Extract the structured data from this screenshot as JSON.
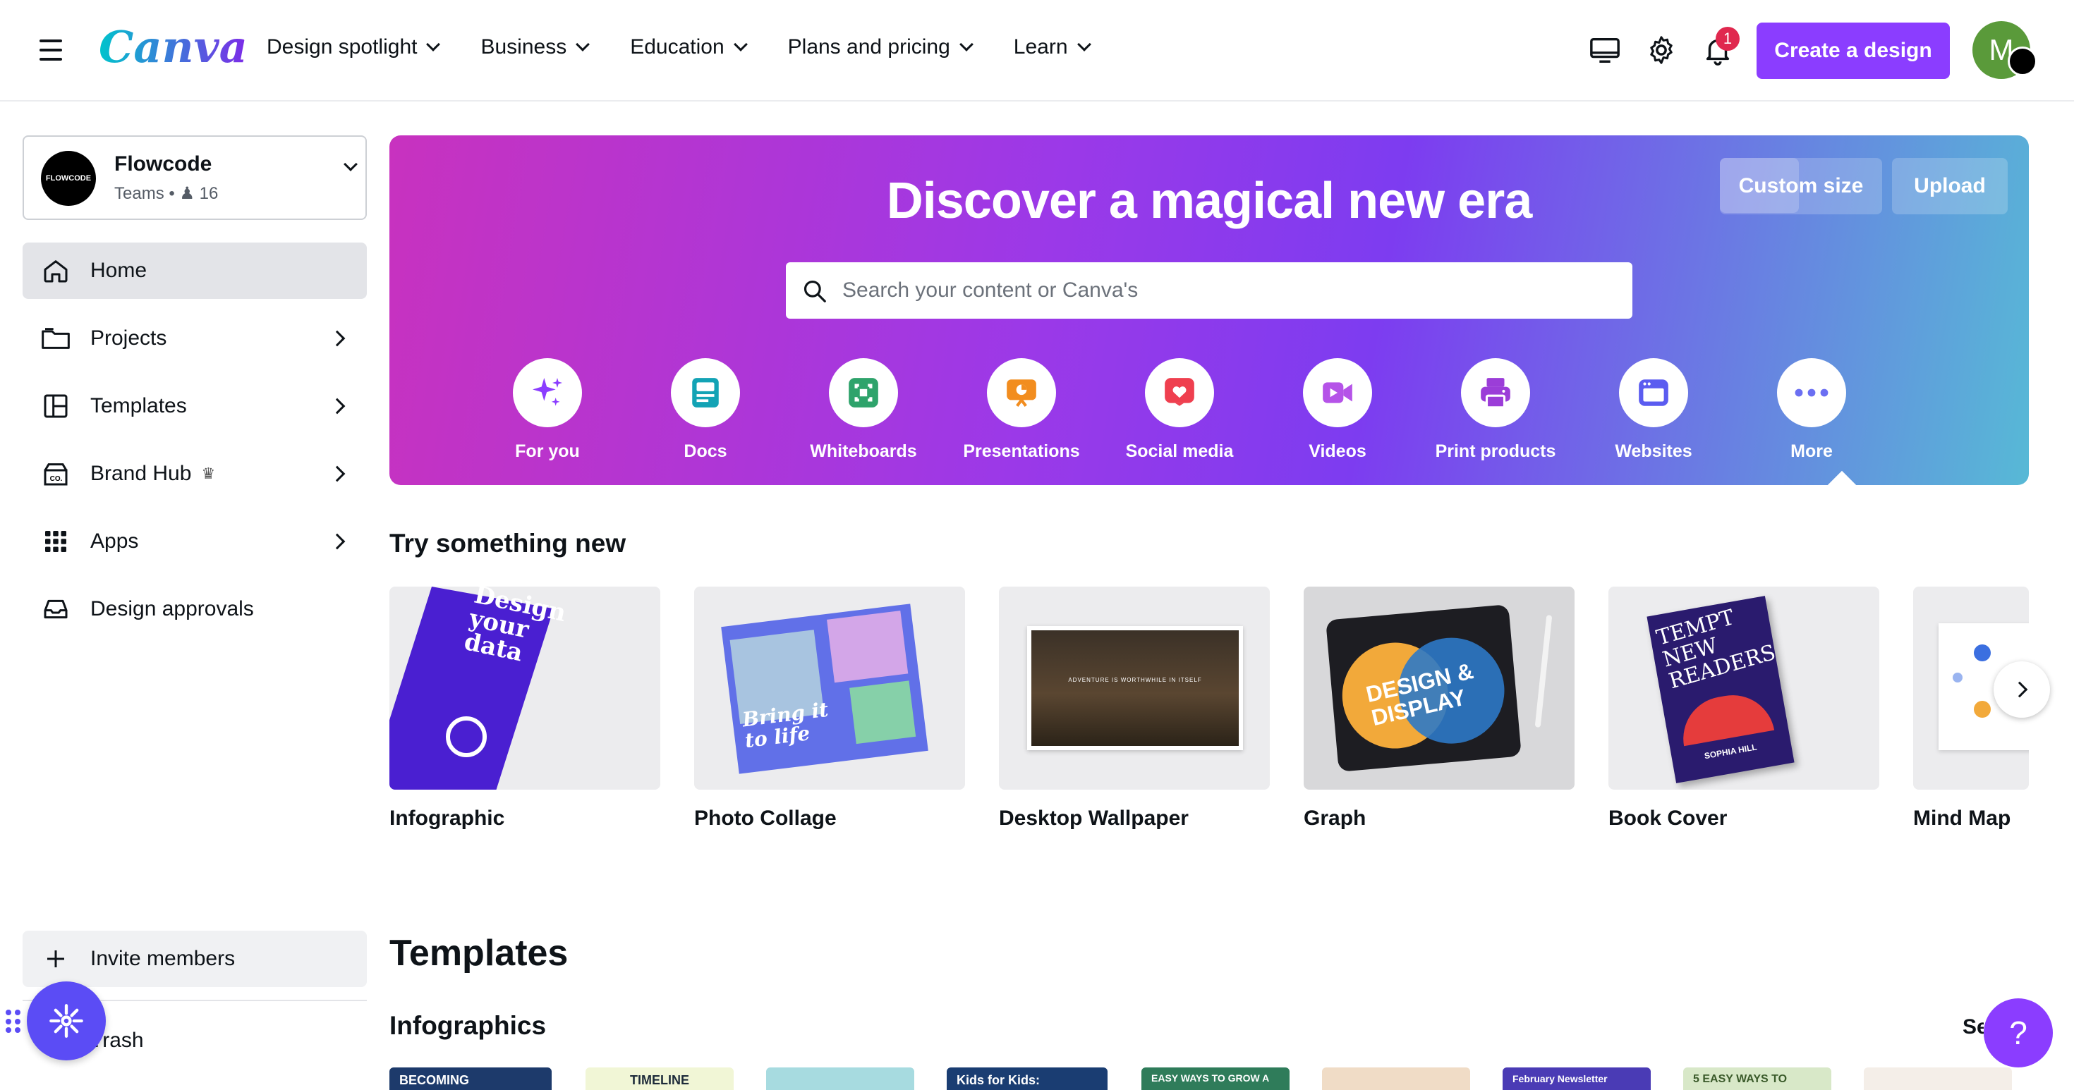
{
  "topbar": {
    "logo": "Canva",
    "nav": [
      "Design spotlight",
      "Business",
      "Education",
      "Plans and pricing",
      "Learn"
    ],
    "notification_count": "1",
    "create_label": "Create a design",
    "avatar_initial": "M"
  },
  "sidebar": {
    "team_logo_text": "FLOWCODE",
    "team_name": "Flowcode",
    "team_type": "Teams",
    "team_members": "16",
    "items": [
      {
        "label": "Home"
      },
      {
        "label": "Projects"
      },
      {
        "label": "Templates"
      },
      {
        "label": "Brand Hub"
      },
      {
        "label": "Apps"
      },
      {
        "label": "Design approvals"
      }
    ],
    "invite_label": "Invite members",
    "trash_label": "Trash"
  },
  "hero": {
    "title": "Discover a magical new era",
    "custom_size": "Custom size",
    "upload": "Upload",
    "search_placeholder": "Search your content or Canva's",
    "categories": [
      {
        "label": "For you",
        "color": "#8b3dff",
        "icon": "sparkle-icon"
      },
      {
        "label": "Docs",
        "color": "#13a3b5",
        "icon": "docs-icon"
      },
      {
        "label": "Whiteboards",
        "color": "#2ea36b",
        "icon": "whiteboard-icon"
      },
      {
        "label": "Presentations",
        "color": "#f28d1f",
        "icon": "presentation-icon"
      },
      {
        "label": "Social media",
        "color": "#ef3f4f",
        "icon": "heart-icon"
      },
      {
        "label": "Videos",
        "color": "#b553e8",
        "icon": "video-icon"
      },
      {
        "label": "Print products",
        "color": "#9b3dd8",
        "icon": "printer-icon"
      },
      {
        "label": "Websites",
        "color": "#5b5cf0",
        "icon": "website-icon"
      },
      {
        "label": "More",
        "color": "#6b6ff2",
        "icon": "more-icon"
      }
    ]
  },
  "try_new": {
    "title": "Try something new",
    "items": [
      {
        "label": "Infographic",
        "thumb_text": "Design your data"
      },
      {
        "label": "Photo Collage",
        "thumb_text": "Bring it to life"
      },
      {
        "label": "Desktop Wallpaper",
        "thumb_text": "ADVENTURE IS WORTHWHILE IN ITSELF"
      },
      {
        "label": "Graph",
        "thumb_text": "DESIGN & DISPLAY"
      },
      {
        "label": "Book Cover",
        "thumb_text": "TEMPT NEW READERS",
        "thumb_sub": "SOPHIA HILL"
      },
      {
        "label": "Mind Map"
      }
    ]
  },
  "templates": {
    "title": "Templates",
    "subtitle": "Infographics",
    "see_all": "See all",
    "thumbs": [
      "BECOMING",
      "TIMELINE",
      "",
      "Kids for Kids:",
      "EASY WAYS TO GROW A",
      "",
      "February Newsletter",
      "5 EASY WAYS TO",
      ""
    ]
  },
  "help_label": "?"
}
